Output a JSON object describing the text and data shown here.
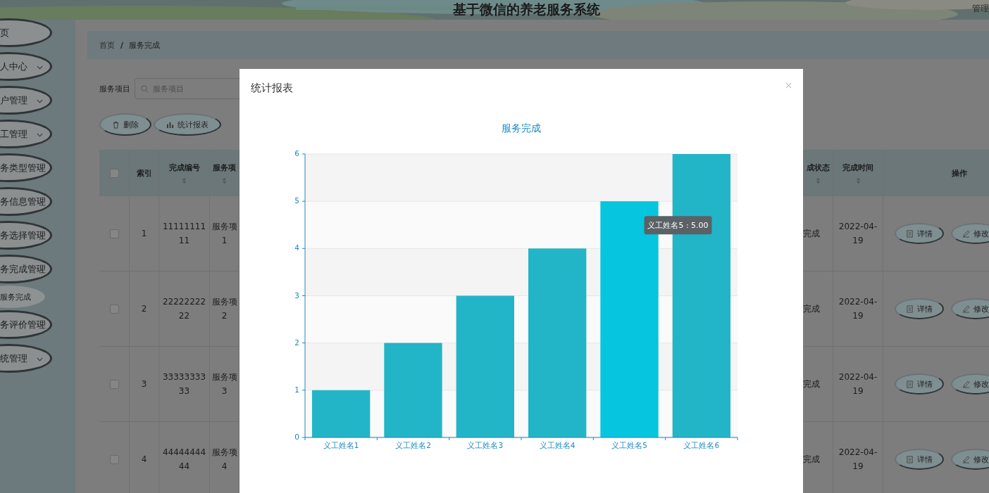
{
  "header": {
    "title": "基于微信的养老服务系统",
    "user": "管理"
  },
  "sidebar": {
    "items": [
      {
        "label": "页",
        "expandable": false
      },
      {
        "label": "人中心",
        "expandable": true
      },
      {
        "label": "户管理",
        "expandable": true
      },
      {
        "label": "工管理",
        "expandable": true
      },
      {
        "label": "务类型管理",
        "expandable": true
      },
      {
        "label": "务信息管理",
        "expandable": true
      },
      {
        "label": "务选择管理",
        "expandable": true
      },
      {
        "label": "务完成管理",
        "expandable": true,
        "children": [
          {
            "label": "服务完成"
          }
        ]
      },
      {
        "label": "务评价管理",
        "expandable": true
      },
      {
        "label": "统管理",
        "expandable": true
      }
    ]
  },
  "breadcrumb": {
    "items": [
      "首页",
      "服务完成"
    ],
    "separator": "/"
  },
  "search": {
    "label": "服务项目",
    "placeholder": "服务项目"
  },
  "buttons": [
    {
      "label": "删除",
      "kind": "delete"
    },
    {
      "label": "统计报表",
      "kind": "chart"
    }
  ],
  "table": {
    "select_all": false,
    "columns": [
      {
        "label": "索引",
        "sortable": false
      },
      {
        "label": "完成编号",
        "sortable": true
      },
      {
        "label": "服务项",
        "sortable": true
      },
      {
        "label": "成状态",
        "sortable": true
      },
      {
        "label": "完成时间",
        "sortable": true
      },
      {
        "label": "操作",
        "sortable": false
      }
    ],
    "rows": [
      {
        "checked": false,
        "index": "1",
        "number": "1111111111",
        "service": "服务项1",
        "status": "完成",
        "time": "2022-04-19",
        "actions": [
          "详情",
          "修改"
        ]
      },
      {
        "checked": false,
        "index": "2",
        "number": "2222222222",
        "service": "服务项2",
        "status": "完成",
        "time": "2022-04-19",
        "actions": [
          "详情",
          "修改"
        ]
      },
      {
        "checked": false,
        "index": "3",
        "number": "3333333333",
        "service": "服务项3",
        "status": "完成",
        "time": "2022-04-19",
        "actions": [
          "详情",
          "修改"
        ]
      },
      {
        "checked": false,
        "index": "4",
        "number": "4444444444",
        "service": "服务项4",
        "status": "完成",
        "time": "2022-04-19",
        "actions": [
          "详情",
          "修改"
        ]
      }
    ]
  },
  "modal": {
    "title": "统计报表",
    "chart_data": {
      "type": "bar",
      "title": "服务完成",
      "categories": [
        "义工姓名1",
        "义工姓名2",
        "义工姓名3",
        "义工姓名4",
        "义工姓名5",
        "义工姓名6"
      ],
      "series": [
        {
          "color": "#22b5c7",
          "values": [
            1,
            2,
            3,
            4,
            5,
            6
          ]
        }
      ],
      "ylim": [
        0,
        6
      ],
      "yticks": [
        0,
        1,
        2,
        3,
        4,
        5,
        6
      ],
      "grid": true
    },
    "bars": [
      {
        "hovered": false
      },
      {
        "hovered": false
      },
      {
        "hovered": false
      },
      {
        "hovered": false
      },
      {
        "hovered": true
      },
      {
        "hovered": false
      }
    ],
    "tooltip": {
      "text": "义工姓名5 : 5.00"
    }
  }
}
